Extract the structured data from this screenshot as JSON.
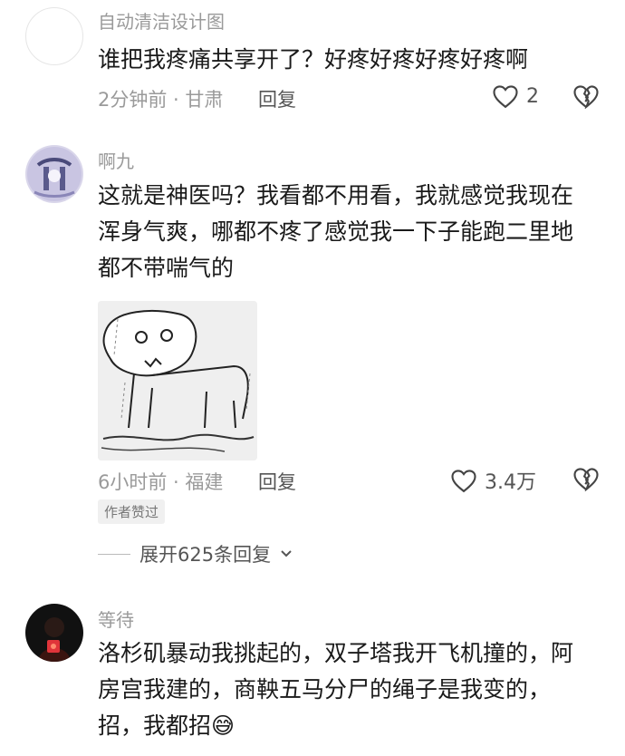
{
  "comments": [
    {
      "username": "自动清洁设计图",
      "text": "谁把我疼痛共享开了？好疼好疼好疼好疼啊",
      "meta": "2分钟前 · 甘肃",
      "reply": "回复",
      "likes": "2"
    },
    {
      "username": "啊九",
      "text_lines": [
        "这就是神医吗？我看都不用看，我就感觉我现在",
        "浑身气爽，哪都不疼了感觉我一下子能跑二里地",
        "都不带喘气的"
      ],
      "meta": "6小时前 · 福建",
      "reply": "回复",
      "likes": "3.4万",
      "badge": "作者赞过"
    },
    {
      "username": "等待",
      "text_lines": [
        "洛杉矶暴动我挑起的，双子塔我开飞机撞的，阿",
        "房宫我建的，商鞅五马分尸的绳子是我变的，",
        "招，我都招"
      ],
      "emoji": "😅"
    }
  ],
  "expand_replies": "展开625条回复"
}
